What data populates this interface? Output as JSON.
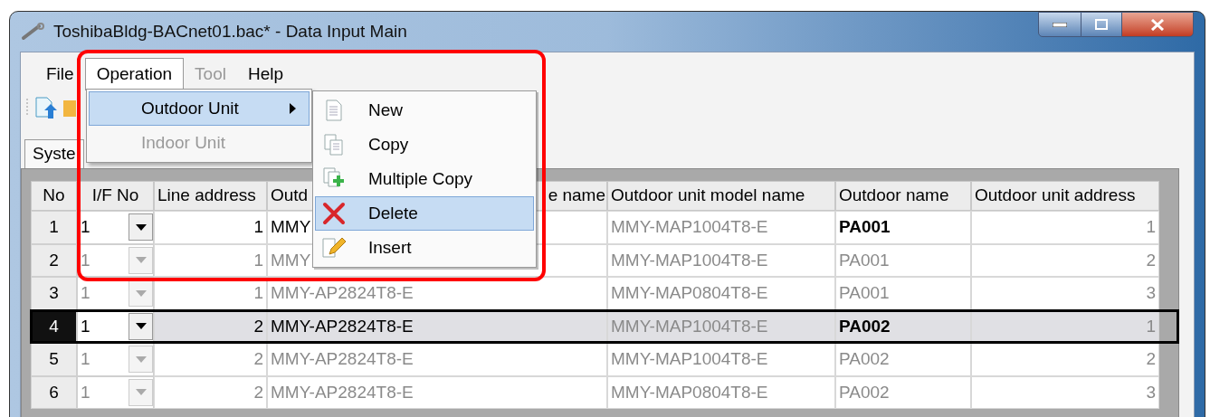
{
  "window": {
    "title": "ToshibaBldg-BACnet01.bac* - Data Input Main"
  },
  "menu_bar": [
    {
      "label": "File",
      "selected": false,
      "disabled": false
    },
    {
      "label": "Operation",
      "selected": true,
      "disabled": false
    },
    {
      "label": "Tool",
      "selected": false,
      "disabled": true
    },
    {
      "label": "Help",
      "selected": false,
      "disabled": false
    }
  ],
  "operation_menu": [
    {
      "label": "Outdoor Unit",
      "selected": true,
      "disabled": false,
      "has_submenu": true
    },
    {
      "label": "Indoor Unit",
      "selected": false,
      "disabled": true,
      "has_submenu": false
    }
  ],
  "outdoor_unit_submenu": [
    {
      "label": "New",
      "kind": "new",
      "selected": false
    },
    {
      "label": "Copy",
      "kind": "copy",
      "selected": false
    },
    {
      "label": "Multiple Copy",
      "kind": "multiple-copy",
      "selected": false
    },
    {
      "label": "Delete",
      "kind": "delete",
      "selected": true
    },
    {
      "label": "Insert",
      "kind": "insert",
      "selected": false
    }
  ],
  "tabs": [
    {
      "label": "Syste",
      "selected": true
    }
  ],
  "table": {
    "columns": [
      "No",
      "I/F No",
      "Line address",
      {
        "start": "Outd",
        "end": "e name"
      },
      "Outdoor unit model name",
      "Outdoor name",
      "Outdoor unit address"
    ],
    "rows": [
      {
        "no": "1",
        "if_no": "1",
        "line_address": "1",
        "column_4": "MMY",
        "model_name": "MMY-MAP1004T8-E",
        "outdoor_name": "PA001",
        "address": "1",
        "enabled": true,
        "selected": false
      },
      {
        "no": "2",
        "if_no": "1",
        "line_address": "1",
        "column_4": "MMY",
        "model_name": "MMY-MAP1004T8-E",
        "outdoor_name": "PA001",
        "address": "2",
        "enabled": false,
        "selected": false
      },
      {
        "no": "3",
        "if_no": "1",
        "line_address": "1",
        "column_4": "MMY-AP2824T8-E",
        "model_name": "MMY-MAP0804T8-E",
        "outdoor_name": "PA001",
        "address": "3",
        "enabled": false,
        "selected": false
      },
      {
        "no": "4",
        "if_no": "1",
        "line_address": "2",
        "column_4": "MMY-AP2824T8-E",
        "model_name": "MMY-MAP1004T8-E",
        "outdoor_name": "PA002",
        "address": "1",
        "enabled": true,
        "selected": true
      },
      {
        "no": "5",
        "if_no": "1",
        "line_address": "2",
        "column_4": "MMY-AP2824T8-E",
        "model_name": "MMY-MAP1004T8-E",
        "outdoor_name": "PA002",
        "address": "2",
        "enabled": false,
        "selected": false
      },
      {
        "no": "6",
        "if_no": "1",
        "line_address": "2",
        "column_4": "MMY-AP2824T8-E",
        "model_name": "MMY-MAP0804T8-E",
        "outdoor_name": "PA002",
        "address": "3",
        "enabled": false,
        "selected": false
      }
    ]
  }
}
